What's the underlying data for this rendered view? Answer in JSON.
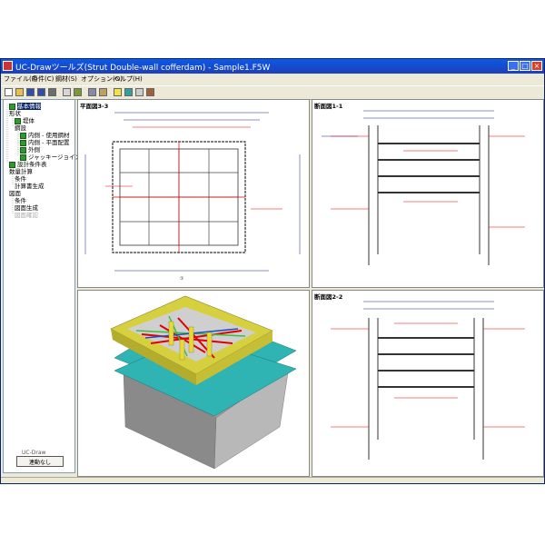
{
  "window": {
    "title": "UC-Drawツールズ(Strut Double-wall cofferdam) - Sample1.F5W",
    "controls": {
      "minimize": "_",
      "maximize": "□",
      "close": "×"
    }
  },
  "menu": [
    {
      "label": "ファイル(F)"
    },
    {
      "label": "条件(C)"
    },
    {
      "label": "鋼材(S)"
    },
    {
      "label": "オプション(O)"
    },
    {
      "label": "ヘルプ(H)"
    }
  ],
  "toolbar": {
    "buttons": [
      "new-file-icon",
      "open-folder-icon",
      "save-icon",
      "save-all-icon",
      "save-as-icon",
      "table-icon",
      "grid-icon",
      "settings-icon",
      "export-icon",
      "help-icon",
      "view3d-icon",
      "camera-icon",
      "tool-icon"
    ]
  },
  "tree": {
    "items": [
      {
        "label": "基本情報",
        "checked": true,
        "selected": true,
        "indent": 0
      },
      {
        "label": "形状",
        "checked": false,
        "indent": 0
      },
      {
        "label": "堤体",
        "checked": true,
        "indent": 1
      },
      {
        "label": "鋼設",
        "checked": false,
        "indent": 1
      },
      {
        "label": "内側 - 使用鋼材",
        "checked": true,
        "indent": 2
      },
      {
        "label": "内側 - 平面配置",
        "checked": true,
        "indent": 2
      },
      {
        "label": "外側",
        "checked": true,
        "indent": 2
      },
      {
        "label": "ジャッキージョイント",
        "checked": true,
        "indent": 2
      },
      {
        "label": "設計条件表",
        "checked": true,
        "indent": 0
      },
      {
        "label": "数量計算",
        "checked": false,
        "indent": 0
      },
      {
        "label": "条件",
        "checked": false,
        "indent": 1
      },
      {
        "label": "計算書生成",
        "checked": false,
        "indent": 1
      },
      {
        "label": "図面",
        "checked": false,
        "indent": 0
      },
      {
        "label": "条件",
        "checked": false,
        "indent": 1
      },
      {
        "label": "図面生成",
        "checked": false,
        "indent": 1
      },
      {
        "label": "図面確認",
        "checked": false,
        "indent": 1,
        "disabled": true
      }
    ],
    "footer_label": "UC-Draw",
    "footer_button": "連動なし"
  },
  "views": {
    "plan_title": "平面図3-3",
    "section1_title": "断面図1-1",
    "section2_title": "断面図2-2",
    "plan_bottom_label": "①"
  },
  "colors": {
    "red": "#e00000",
    "blue": "#1a1aa0",
    "yellow_wall": "#d6cf3e",
    "teal_plate": "#2fb3b3",
    "green_strut": "#3bbf3b",
    "grey_box": "#9a9a9a",
    "titlebar": "#1f3fb6"
  }
}
